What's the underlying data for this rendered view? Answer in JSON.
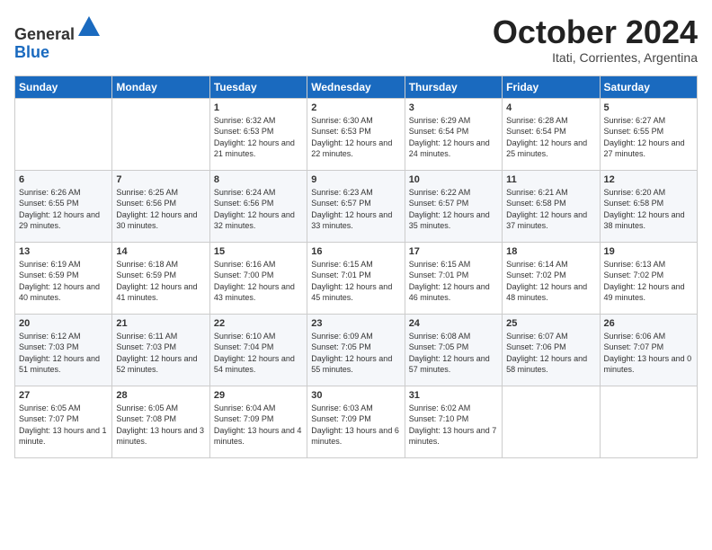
{
  "header": {
    "logo_line1": "General",
    "logo_line2": "Blue",
    "month": "October 2024",
    "location": "Itati, Corrientes, Argentina"
  },
  "days_of_week": [
    "Sunday",
    "Monday",
    "Tuesday",
    "Wednesday",
    "Thursday",
    "Friday",
    "Saturday"
  ],
  "weeks": [
    [
      {
        "day": "",
        "content": ""
      },
      {
        "day": "",
        "content": ""
      },
      {
        "day": "1",
        "content": "Sunrise: 6:32 AM\nSunset: 6:53 PM\nDaylight: 12 hours and 21 minutes."
      },
      {
        "day": "2",
        "content": "Sunrise: 6:30 AM\nSunset: 6:53 PM\nDaylight: 12 hours and 22 minutes."
      },
      {
        "day": "3",
        "content": "Sunrise: 6:29 AM\nSunset: 6:54 PM\nDaylight: 12 hours and 24 minutes."
      },
      {
        "day": "4",
        "content": "Sunrise: 6:28 AM\nSunset: 6:54 PM\nDaylight: 12 hours and 25 minutes."
      },
      {
        "day": "5",
        "content": "Sunrise: 6:27 AM\nSunset: 6:55 PM\nDaylight: 12 hours and 27 minutes."
      }
    ],
    [
      {
        "day": "6",
        "content": "Sunrise: 6:26 AM\nSunset: 6:55 PM\nDaylight: 12 hours and 29 minutes."
      },
      {
        "day": "7",
        "content": "Sunrise: 6:25 AM\nSunset: 6:56 PM\nDaylight: 12 hours and 30 minutes."
      },
      {
        "day": "8",
        "content": "Sunrise: 6:24 AM\nSunset: 6:56 PM\nDaylight: 12 hours and 32 minutes."
      },
      {
        "day": "9",
        "content": "Sunrise: 6:23 AM\nSunset: 6:57 PM\nDaylight: 12 hours and 33 minutes."
      },
      {
        "day": "10",
        "content": "Sunrise: 6:22 AM\nSunset: 6:57 PM\nDaylight: 12 hours and 35 minutes."
      },
      {
        "day": "11",
        "content": "Sunrise: 6:21 AM\nSunset: 6:58 PM\nDaylight: 12 hours and 37 minutes."
      },
      {
        "day": "12",
        "content": "Sunrise: 6:20 AM\nSunset: 6:58 PM\nDaylight: 12 hours and 38 minutes."
      }
    ],
    [
      {
        "day": "13",
        "content": "Sunrise: 6:19 AM\nSunset: 6:59 PM\nDaylight: 12 hours and 40 minutes."
      },
      {
        "day": "14",
        "content": "Sunrise: 6:18 AM\nSunset: 6:59 PM\nDaylight: 12 hours and 41 minutes."
      },
      {
        "day": "15",
        "content": "Sunrise: 6:16 AM\nSunset: 7:00 PM\nDaylight: 12 hours and 43 minutes."
      },
      {
        "day": "16",
        "content": "Sunrise: 6:15 AM\nSunset: 7:01 PM\nDaylight: 12 hours and 45 minutes."
      },
      {
        "day": "17",
        "content": "Sunrise: 6:15 AM\nSunset: 7:01 PM\nDaylight: 12 hours and 46 minutes."
      },
      {
        "day": "18",
        "content": "Sunrise: 6:14 AM\nSunset: 7:02 PM\nDaylight: 12 hours and 48 minutes."
      },
      {
        "day": "19",
        "content": "Sunrise: 6:13 AM\nSunset: 7:02 PM\nDaylight: 12 hours and 49 minutes."
      }
    ],
    [
      {
        "day": "20",
        "content": "Sunrise: 6:12 AM\nSunset: 7:03 PM\nDaylight: 12 hours and 51 minutes."
      },
      {
        "day": "21",
        "content": "Sunrise: 6:11 AM\nSunset: 7:03 PM\nDaylight: 12 hours and 52 minutes."
      },
      {
        "day": "22",
        "content": "Sunrise: 6:10 AM\nSunset: 7:04 PM\nDaylight: 12 hours and 54 minutes."
      },
      {
        "day": "23",
        "content": "Sunrise: 6:09 AM\nSunset: 7:05 PM\nDaylight: 12 hours and 55 minutes."
      },
      {
        "day": "24",
        "content": "Sunrise: 6:08 AM\nSunset: 7:05 PM\nDaylight: 12 hours and 57 minutes."
      },
      {
        "day": "25",
        "content": "Sunrise: 6:07 AM\nSunset: 7:06 PM\nDaylight: 12 hours and 58 minutes."
      },
      {
        "day": "26",
        "content": "Sunrise: 6:06 AM\nSunset: 7:07 PM\nDaylight: 13 hours and 0 minutes."
      }
    ],
    [
      {
        "day": "27",
        "content": "Sunrise: 6:05 AM\nSunset: 7:07 PM\nDaylight: 13 hours and 1 minute."
      },
      {
        "day": "28",
        "content": "Sunrise: 6:05 AM\nSunset: 7:08 PM\nDaylight: 13 hours and 3 minutes."
      },
      {
        "day": "29",
        "content": "Sunrise: 6:04 AM\nSunset: 7:09 PM\nDaylight: 13 hours and 4 minutes."
      },
      {
        "day": "30",
        "content": "Sunrise: 6:03 AM\nSunset: 7:09 PM\nDaylight: 13 hours and 6 minutes."
      },
      {
        "day": "31",
        "content": "Sunrise: 6:02 AM\nSunset: 7:10 PM\nDaylight: 13 hours and 7 minutes."
      },
      {
        "day": "",
        "content": ""
      },
      {
        "day": "",
        "content": ""
      }
    ]
  ]
}
